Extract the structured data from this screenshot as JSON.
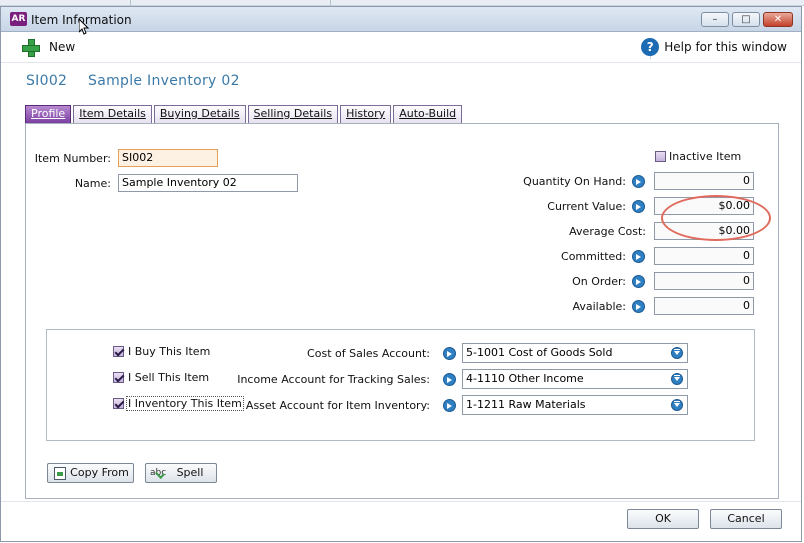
{
  "window": {
    "app_logo": "AR",
    "title": "Item Information",
    "buttons": {
      "minimize": "–",
      "maximize": "□",
      "close": "✕"
    }
  },
  "toolbar": {
    "new_label": "New",
    "help_label": "Help for this window"
  },
  "item_header": {
    "number": "SI002",
    "name": "Sample Inventory 02"
  },
  "tabs": [
    {
      "label": "Profile",
      "active": true
    },
    {
      "label": "Item Details",
      "active": false
    },
    {
      "label": "Buying Details",
      "active": false
    },
    {
      "label": "Selling Details",
      "active": false
    },
    {
      "label": "History",
      "active": false
    },
    {
      "label": "Auto-Build",
      "active": false
    }
  ],
  "profile": {
    "item_number_label": "Item Number:",
    "item_number_value": "SI002",
    "name_label": "Name:",
    "name_value": "Sample Inventory 02",
    "inactive_label": "Inactive Item",
    "quantities": {
      "qty_on_hand_label": "Quantity On Hand:",
      "qty_on_hand_value": "0",
      "current_value_label": "Current Value:",
      "current_value_value": "$0.00",
      "average_cost_label": "Average Cost:",
      "average_cost_value": "$0.00",
      "committed_label": "Committed:",
      "committed_value": "0",
      "on_order_label": "On Order:",
      "on_order_value": "0",
      "available_label": "Available:",
      "available_value": "0"
    },
    "flags": {
      "buy_label": "I Buy This Item",
      "sell_label": "I Sell This Item",
      "inventory_label": "I Inventory This Item"
    },
    "accounts": {
      "cost_of_sales_label": "Cost of Sales Account:",
      "cost_of_sales_value": "5-1001 Cost of Goods Sold",
      "income_label": "Income Account for Tracking Sales:",
      "income_value": "4-1110 Other Income",
      "asset_label": "Asset Account for Item Inventory:",
      "asset_value": "1-1211 Raw Materials"
    },
    "copy_from_label": "Copy From",
    "spell_label": "Spell",
    "spell_icon_text": "abc"
  },
  "footer": {
    "ok_label": "OK",
    "cancel_label": "Cancel"
  },
  "colors": {
    "accent": "#7b3fa1",
    "link": "#3b7aa8",
    "annotation": "#e06a5c"
  }
}
